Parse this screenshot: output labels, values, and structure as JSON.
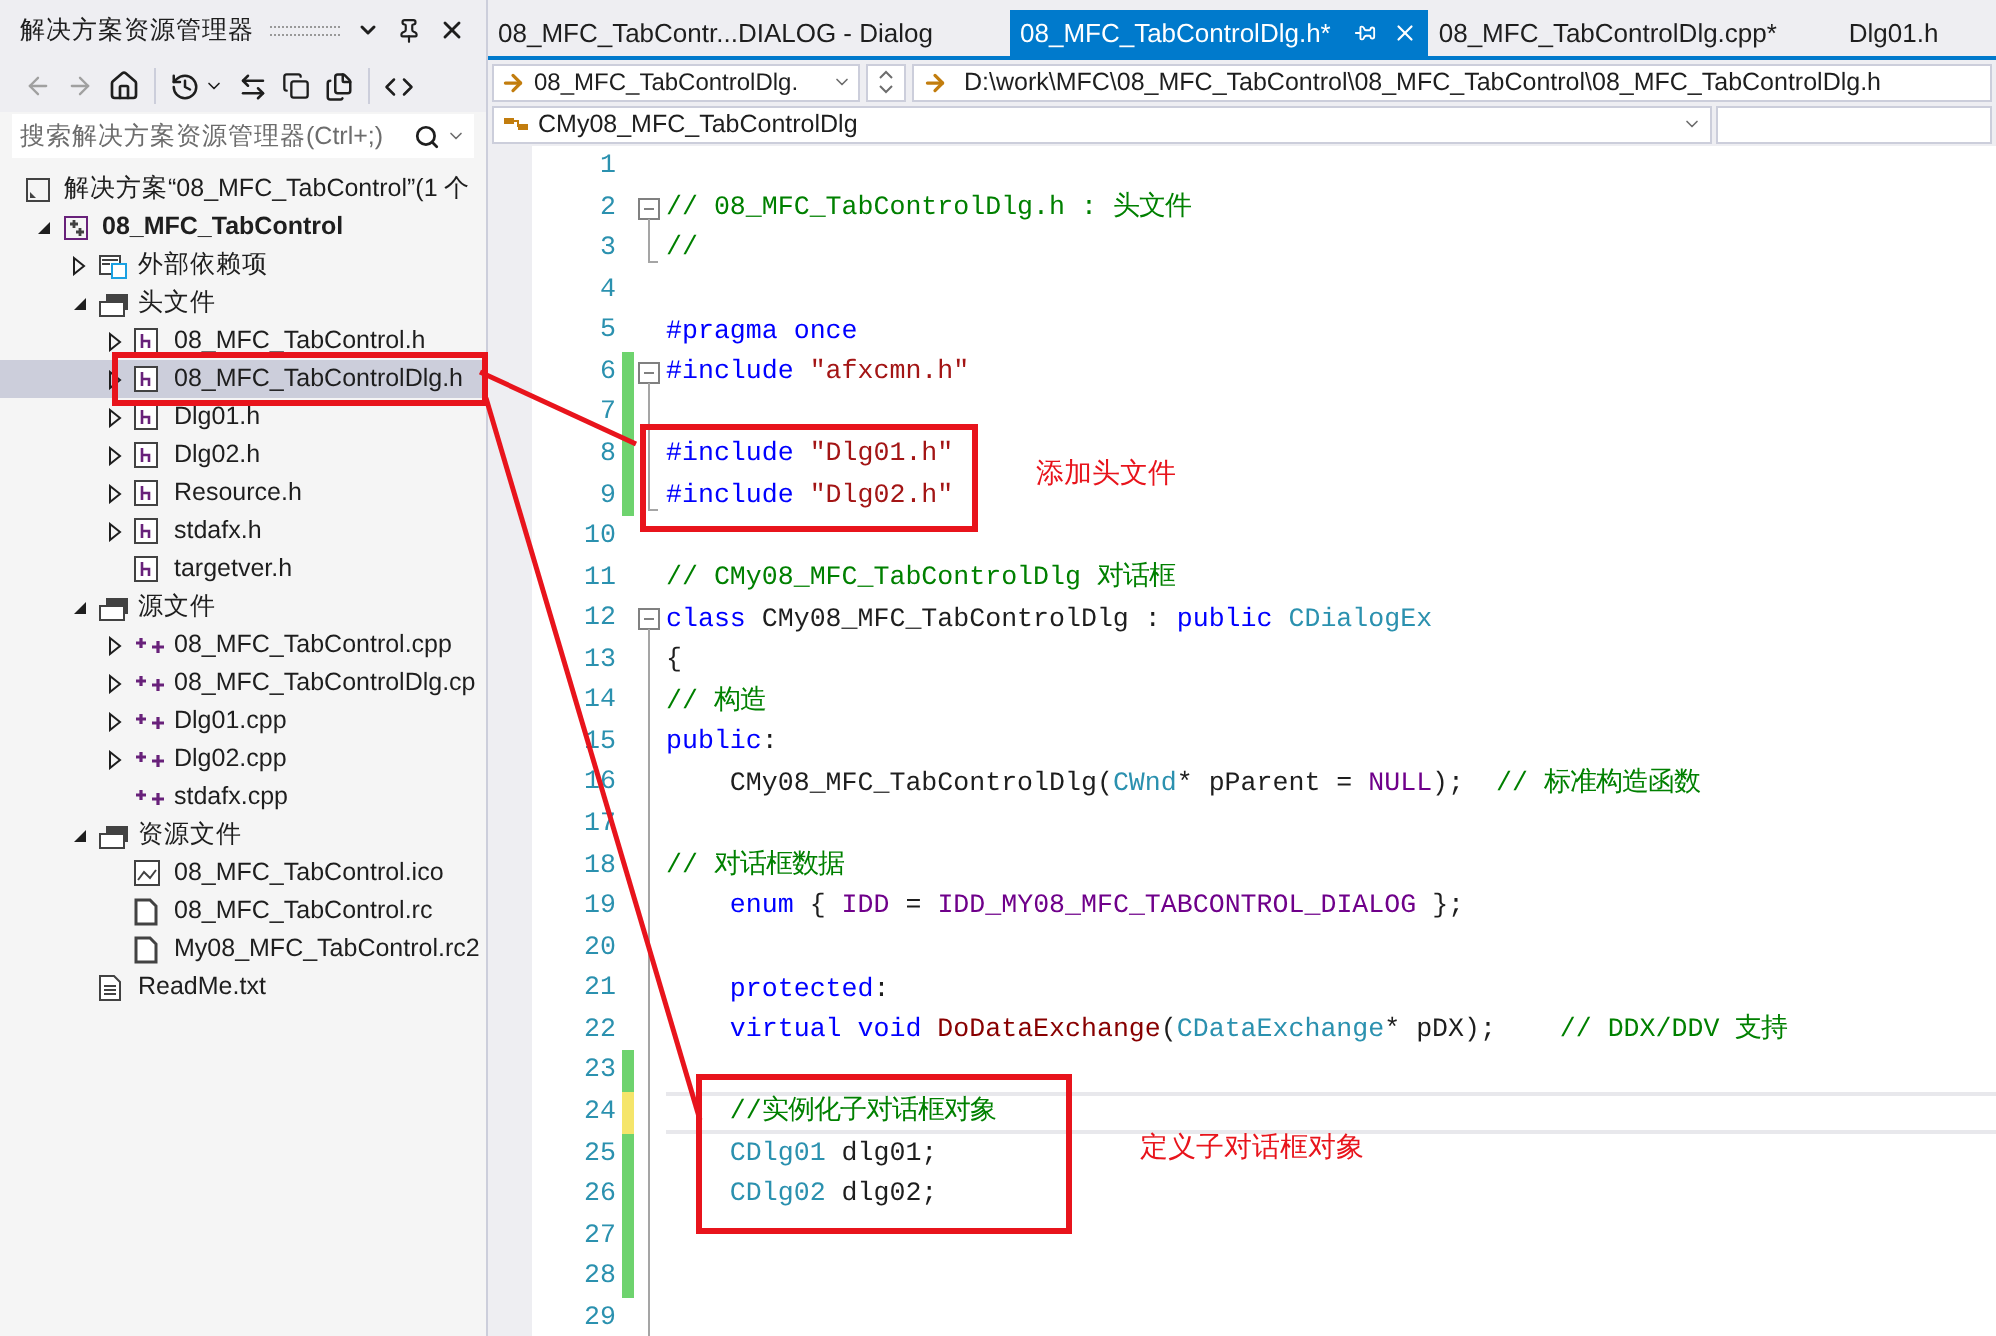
{
  "explorer": {
    "title": "解决方案资源管理器",
    "search": {
      "placeholder": "搜索解决方案资源管理器(Ctrl+;)"
    },
    "tree": [
      {
        "label": "解决方案“08_MFC_TabControl”(1 个",
        "kind": "solution",
        "selected": false
      },
      {
        "label": "08_MFC_TabControl",
        "kind": "project",
        "expanded": true,
        "selected": false,
        "children": [
          {
            "label": "外部依赖项",
            "kind": "deps",
            "expanded": false,
            "selected": false
          },
          {
            "label": "头文件",
            "kind": "folder",
            "expanded": true,
            "selected": false,
            "children": [
              {
                "label": "08_MFC_TabControl.h",
                "kind": "header",
                "expanded": false,
                "selected": false
              },
              {
                "label": "08_MFC_TabControlDlg.h",
                "kind": "header",
                "expanded": false,
                "selected": true
              },
              {
                "label": "Dlg01.h",
                "kind": "header",
                "expanded": false,
                "selected": false
              },
              {
                "label": "Dlg02.h",
                "kind": "header",
                "expanded": false,
                "selected": false
              },
              {
                "label": "Resource.h",
                "kind": "header",
                "expanded": false,
                "selected": false
              },
              {
                "label": "stdafx.h",
                "kind": "header",
                "expanded": false,
                "selected": false
              },
              {
                "label": "targetver.h",
                "kind": "header",
                "selected": false
              }
            ]
          },
          {
            "label": "源文件",
            "kind": "folder",
            "expanded": true,
            "selected": false,
            "children": [
              {
                "label": "08_MFC_TabControl.cpp",
                "kind": "cpp",
                "expanded": false,
                "selected": false
              },
              {
                "label": "08_MFC_TabControlDlg.cp",
                "kind": "cpp",
                "expanded": false,
                "selected": false
              },
              {
                "label": "Dlg01.cpp",
                "kind": "cpp",
                "expanded": false,
                "selected": false
              },
              {
                "label": "Dlg02.cpp",
                "kind": "cpp",
                "expanded": false,
                "selected": false
              },
              {
                "label": "stdafx.cpp",
                "kind": "cpp",
                "selected": false
              }
            ]
          },
          {
            "label": "资源文件",
            "kind": "folder",
            "expanded": true,
            "selected": false,
            "children": [
              {
                "label": "08_MFC_TabControl.ico",
                "kind": "image",
                "selected": false
              },
              {
                "label": "08_MFC_TabControl.rc",
                "kind": "resource",
                "selected": false
              },
              {
                "label": "My08_MFC_TabControl.rc2",
                "kind": "resource",
                "selected": false
              }
            ]
          },
          {
            "label": "ReadMe.txt",
            "kind": "text",
            "selected": false
          }
        ]
      }
    ]
  },
  "tabs": [
    {
      "label": "08_MFC_TabContr...DIALOG - Dialog",
      "selected": false
    },
    {
      "label": "08_MFC_TabControlDlg.h*",
      "selected": true
    },
    {
      "label": "08_MFC_TabControlDlg.cpp*",
      "selected": false
    },
    {
      "label": "Dlg01.h",
      "selected": false
    }
  ],
  "navigation": {
    "file": "08_MFC_TabControlDlg.",
    "path": "D:\\work\\MFC\\08_MFC_TabControl\\08_MFC_TabControl\\08_MFC_TabControlDlg.h",
    "class": "CMy08_MFC_TabControlDlg"
  },
  "editor": {
    "lines": [
      {
        "n": "1",
        "kind": "plain",
        "changed": false,
        "current": false
      },
      {
        "n": "2",
        "kind": "fold_start",
        "changed": false,
        "current": false,
        "code": [
          {
            "text": "// 08_MFC_TabControlDlg.h : 头文件",
            "kind": "comment"
          }
        ]
      },
      {
        "n": "3",
        "kind": "fold_end",
        "changed": false,
        "current": false,
        "code": [
          {
            "text": "//",
            "kind": "comment"
          }
        ]
      },
      {
        "n": "4",
        "kind": "plain",
        "changed": false,
        "current": false
      },
      {
        "n": "5",
        "kind": "plain",
        "changed": false,
        "current": false,
        "code": [
          {
            "text": "#pragma once",
            "kind": "keyword"
          }
        ]
      },
      {
        "n": "6",
        "kind": "fold_start",
        "changed": true,
        "saved": true,
        "current": false,
        "code": [
          {
            "text": "#include",
            "kind": "keyword"
          },
          {
            "text": " \"afxcmn.h\"",
            "kind": "string"
          }
        ]
      },
      {
        "n": "7",
        "kind": "fold_inside",
        "changed": true,
        "saved": true,
        "current": false
      },
      {
        "n": "8",
        "kind": "fold_inside",
        "changed": true,
        "saved": true,
        "current": false,
        "code": [
          {
            "text": "#include",
            "kind": "keyword"
          },
          {
            "text": " \"Dlg01.h\"",
            "kind": "string"
          }
        ]
      },
      {
        "n": "9",
        "kind": "fold_end",
        "changed": true,
        "saved": true,
        "current": false,
        "code": [
          {
            "text": "#include",
            "kind": "keyword"
          },
          {
            "text": " \"Dlg02.h\"",
            "kind": "string"
          }
        ]
      },
      {
        "n": "10",
        "kind": "plain",
        "changed": false,
        "current": false
      },
      {
        "n": "11",
        "kind": "plain",
        "changed": false,
        "current": false,
        "code": [
          {
            "text": "// CMy08_MFC_TabControlDlg 对话框",
            "kind": "comment"
          }
        ]
      },
      {
        "n": "12",
        "kind": "fold_start",
        "changed": false,
        "current": false,
        "code": [
          {
            "text": "class",
            "kind": "keyword"
          },
          {
            "text": " CMy08_MFC_TabControlDlg : ",
            "kind": "plain"
          },
          {
            "text": "public",
            "kind": "keyword"
          },
          {
            "text": " CDialogEx",
            "kind": "type"
          }
        ]
      },
      {
        "n": "13",
        "kind": "fold_inside",
        "changed": false,
        "current": false,
        "code": [
          {
            "text": "{",
            "kind": "plain"
          }
        ]
      },
      {
        "n": "14",
        "kind": "fold_inside",
        "changed": false,
        "current": false,
        "code": [
          {
            "text": "// 构造",
            "kind": "comment"
          }
        ]
      },
      {
        "n": "15",
        "kind": "fold_inside",
        "changed": false,
        "current": false,
        "code": [
          {
            "text": "public",
            "kind": "keyword"
          },
          {
            "text": ":",
            "kind": "plain"
          }
        ]
      },
      {
        "n": "16",
        "kind": "fold_inside",
        "changed": false,
        "current": false,
        "code": [
          {
            "text": "    CMy08_MFC_TabControlDlg(",
            "kind": "plain"
          },
          {
            "text": "CWnd",
            "kind": "type"
          },
          {
            "text": "* pParent = ",
            "kind": "plain"
          },
          {
            "text": "NULL",
            "kind": "macro"
          },
          {
            "text": ");  ",
            "kind": "plain"
          },
          {
            "text": "// 标准构造函数",
            "kind": "comment"
          }
        ]
      },
      {
        "n": "17",
        "kind": "fold_inside",
        "changed": false,
        "current": false
      },
      {
        "n": "18",
        "kind": "fold_inside",
        "changed": false,
        "current": false,
        "code": [
          {
            "text": "// 对话框数据",
            "kind": "comment"
          }
        ]
      },
      {
        "n": "19",
        "kind": "fold_inside",
        "changed": false,
        "current": false,
        "code": [
          {
            "text": "    enum",
            "kind": "keyword"
          },
          {
            "text": " { ",
            "kind": "plain"
          },
          {
            "text": "IDD",
            "kind": "macro"
          },
          {
            "text": " = ",
            "kind": "plain"
          },
          {
            "text": "IDD_MY08_MFC_TABCONTROL_DIALOG",
            "kind": "macro"
          },
          {
            "text": " };",
            "kind": "plain"
          }
        ]
      },
      {
        "n": "20",
        "kind": "fold_inside",
        "changed": false,
        "current": false
      },
      {
        "n": "21",
        "kind": "fold_inside",
        "changed": false,
        "current": false,
        "code": [
          {
            "text": "    protected",
            "kind": "keyword"
          },
          {
            "text": ":",
            "kind": "plain"
          }
        ]
      },
      {
        "n": "22",
        "kind": "fold_inside",
        "changed": false,
        "current": false,
        "code": [
          {
            "text": "    virtual",
            "kind": "keyword"
          },
          {
            "text": " void",
            "kind": "keyword"
          },
          {
            "text": " DoDataExchange",
            "kind": "func"
          },
          {
            "text": "(",
            "kind": "plain"
          },
          {
            "text": "CDataExchange",
            "kind": "type"
          },
          {
            "text": "* pDX);    ",
            "kind": "plain"
          },
          {
            "text": "// DDX/DDV 支持",
            "kind": "comment"
          }
        ]
      },
      {
        "n": "23",
        "kind": "fold_inside",
        "changed": true,
        "saved": true,
        "current": false
      },
      {
        "n": "24",
        "kind": "fold_inside",
        "changed": true,
        "saved": false,
        "current": true,
        "code": [
          {
            "text": "    //实例化子对话框对象",
            "kind": "comment"
          }
        ]
      },
      {
        "n": "25",
        "kind": "fold_inside",
        "changed": true,
        "saved": true,
        "current": false,
        "code": [
          {
            "text": "    CDlg01",
            "kind": "type"
          },
          {
            "text": " dlg01;",
            "kind": "plain"
          }
        ]
      },
      {
        "n": "26",
        "kind": "fold_inside",
        "changed": true,
        "saved": true,
        "current": false,
        "code": [
          {
            "text": "    CDlg02",
            "kind": "type"
          },
          {
            "text": " dlg02;",
            "kind": "plain"
          }
        ]
      },
      {
        "n": "27",
        "kind": "fold_inside",
        "changed": true,
        "saved": true,
        "current": false
      },
      {
        "n": "28",
        "kind": "fold_inside",
        "changed": true,
        "saved": true,
        "current": false
      },
      {
        "n": "29",
        "kind": "fold_inside",
        "changed": false,
        "current": false
      }
    ]
  },
  "annotations": [
    {
      "label": "添加头文件"
    },
    {
      "label": "定义子对话框对象"
    }
  ]
}
